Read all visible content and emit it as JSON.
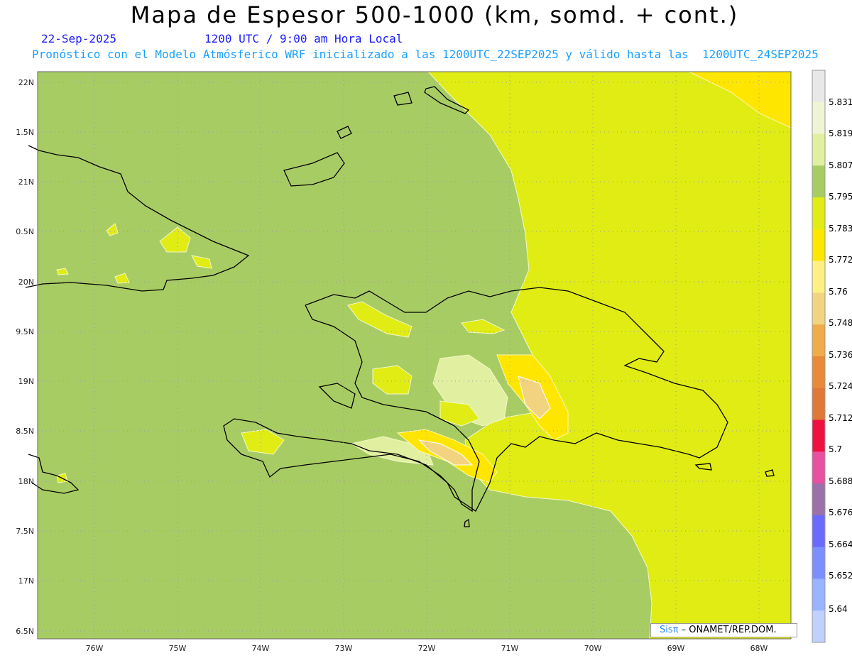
{
  "header": {
    "title": "Mapa de Espesor 500-1000 (km, somd. + cont.)",
    "date": "22-Sep-2025",
    "time": "1200 UTC / 9:00 am Hora Local",
    "subtitle": "Pronóstico con el Modelo Atmósferico WRF inicializado a las 1200UTC_22SEP2025 y válido hasta las  1200UTC_24SEP2025"
  },
  "axes": {
    "lat_labels": [
      "22N",
      "1.5N",
      "21N",
      "0.5N",
      "20N",
      "9.5N",
      "19N",
      "8.5N",
      "18N",
      "7.5N",
      "17N",
      "6.5N"
    ],
    "lon_labels": [
      "76W",
      "75W",
      "74W",
      "73W",
      "72W",
      "71W",
      "70W",
      "69W",
      "68W"
    ]
  },
  "legend": {
    "labels": [
      "5.831",
      "5.819",
      "5.807",
      "5.795",
      "5.783",
      "5.772",
      "5.76",
      "5.748",
      "5.736",
      "5.724",
      "5.712",
      "5.7",
      "5.688",
      "5.676",
      "5.664",
      "5.652",
      "5.64"
    ],
    "colors": [
      "#e8e8e8",
      "#eff5d4",
      "#e0f0a0",
      "#a8cc64",
      "#e0ec14",
      "#ffe600",
      "#fff084",
      "#f2d480",
      "#f0ac48",
      "#e88a38",
      "#e07838",
      "#f01040",
      "#e850a0",
      "#9c70a8",
      "#6a6aff",
      "#7a90ff",
      "#98b4ff",
      "#c0d0ff"
    ]
  },
  "credit": {
    "brand": "Sisπ",
    "text": "– ONAMET/REP.DOM."
  }
}
